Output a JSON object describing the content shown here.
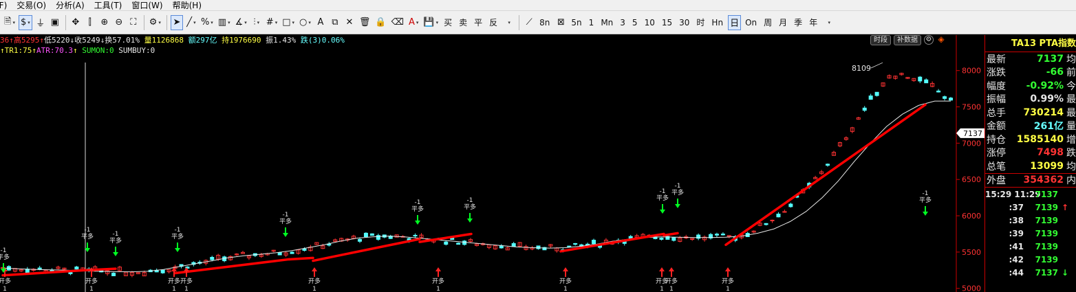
{
  "menu": [
    "文件(F)",
    "交易(O)",
    "分析(A)",
    "工具(T)",
    "窗口(W)",
    "帮助(H)"
  ],
  "toolbar": {
    "periods": [
      "8n",
      "Mn",
      "5n",
      "1",
      "Mn",
      "3",
      "5",
      "10",
      "15",
      "30",
      "时",
      "Hn",
      "日",
      "On",
      "周",
      "月",
      "季",
      "年"
    ],
    "trade_labels": [
      "买",
      "卖",
      "平",
      "反"
    ]
  },
  "info1": {
    "open": "36",
    "high": "高5295",
    "low": "低5220",
    "close": "收5249",
    "turnover": "换57.01%",
    "volume": "量1126868",
    "amount": "额297亿",
    "open_interest": "持1976690",
    "amplitude": "振1.43%",
    "change": "跌(3)0.06%"
  },
  "info2": {
    "tr": "TR1:75",
    "atr": "ATR:70.3",
    "sumon": "SUMON:0",
    "sumbuy": "SUMBUY:0"
  },
  "chart_buttons": {
    "time": "时段",
    "supplement": "补数据"
  },
  "chart_data": {
    "type": "candlestick",
    "ylim": [
      4950,
      8300
    ],
    "y_ticks": [
      5000,
      5500,
      6000,
      6500,
      7000,
      7500,
      8000
    ],
    "current_price_label": "7137",
    "peak_label": "8109",
    "peak_value": 8109,
    "signal_labels": {
      "open": "开多",
      "close": "平多",
      "buy_qty": "1",
      "sell_qty": "-1"
    },
    "colors": {
      "up": "#ff3333",
      "down": "#54ffff",
      "ma": "#e8e8e8",
      "trend": "#ff0000",
      "buy": "#ff2222",
      "sell": "#00ff22"
    },
    "ma_line": [
      5280,
      5270,
      5260,
      5255,
      5250,
      5240,
      5235,
      5230,
      5228,
      5235,
      5260,
      5300,
      5340,
      5380,
      5420,
      5450,
      5470,
      5490,
      5520,
      5560,
      5600,
      5650,
      5690,
      5710,
      5720,
      5710,
      5690,
      5670,
      5650,
      5630,
      5610,
      5590,
      5570,
      5560,
      5555,
      5560,
      5580,
      5610,
      5650,
      5680,
      5700,
      5710,
      5705,
      5700,
      5700,
      5705,
      5720,
      5760,
      5820,
      5920,
      6060,
      6250,
      6480,
      6750,
      7000,
      7230,
      7400,
      7520,
      7580,
      7580
    ],
    "trend_segments": [
      [
        5180,
        5250
      ],
      [
        5250,
        5270
      ],
      [
        5210,
        5400
      ],
      [
        5400,
        5420
      ],
      [
        5380,
        5680
      ],
      [
        5640,
        5750
      ],
      [
        5510,
        5750
      ],
      [
        5730,
        5760
      ],
      [
        5600,
        7530
      ]
    ],
    "buy_signals": [
      0,
      13,
      21,
      37,
      45,
      53,
      63,
      80,
      81,
      97
    ],
    "sell_signals": [
      1,
      10,
      12,
      23,
      37,
      51,
      59,
      67,
      77,
      79,
      105
    ]
  },
  "panel": {
    "title": "TA13 PTA指数",
    "quotes": [
      {
        "label": "最新",
        "value": "7137",
        "color": "#33ff33",
        "extra": "均"
      },
      {
        "label": "涨跌",
        "value": "-66",
        "color": "#33ff33",
        "extra": "前"
      },
      {
        "label": "幅度",
        "value": "-0.92%",
        "color": "#33ff33",
        "extra": "今"
      },
      {
        "label": "振幅",
        "value": "0.99%",
        "color": "#e6e6e6",
        "extra": "最"
      },
      {
        "label": "总手",
        "value": "730214",
        "color": "#ffff44",
        "extra": "最"
      },
      {
        "label": "金额",
        "value": "261亿",
        "color": "#66ffff",
        "extra": "量"
      },
      {
        "label": "持仓",
        "value": "1585140",
        "color": "#ffff44",
        "extra": "增"
      },
      {
        "label": "涨停",
        "value": "7498",
        "color": "#ff3333",
        "extra": "跌"
      },
      {
        "label": "总笔",
        "value": "13099",
        "color": "#ffff44",
        "extra": "均"
      }
    ],
    "outer": {
      "label": "外盘",
      "value": "354362",
      "color": "#ff3333",
      "extra": "内"
    },
    "ticks": [
      {
        "time": "15:29 11:29",
        "price": "7137",
        "arrow": ""
      },
      {
        "time": ":37",
        "price": "7139",
        "arrow": "↑"
      },
      {
        "time": ":38",
        "price": "7139",
        "arrow": ""
      },
      {
        "time": ":39",
        "price": "7139",
        "arrow": ""
      },
      {
        "time": ":41",
        "price": "7139",
        "arrow": ""
      },
      {
        "time": ":42",
        "price": "7139",
        "arrow": ""
      },
      {
        "time": ":44",
        "price": "7137",
        "arrow": "↓"
      }
    ]
  }
}
